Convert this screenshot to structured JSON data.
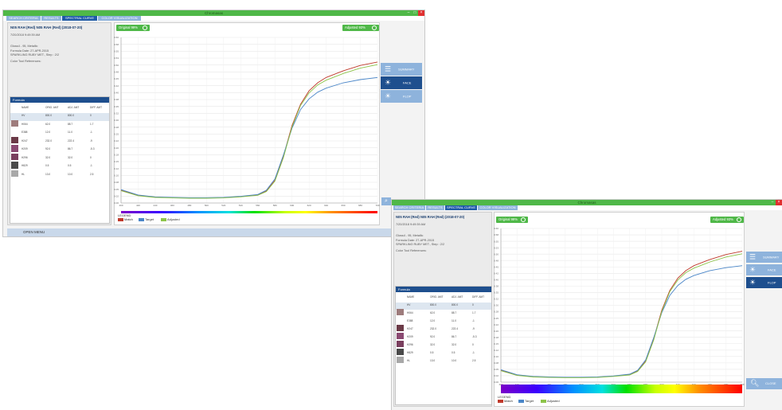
{
  "app": {
    "title": "Chromasas",
    "tabs": [
      "SEARCH CRITERIA",
      "RESULTS",
      "SPECTRAL CURVE",
      "COLOR VISUALIZATION"
    ],
    "active_tab": 2
  },
  "color": {
    "title": "N05 RAH (Red) N05 RAH (Red) (2018-07-20)",
    "date": "7/20/2018 9:49:39 AM",
    "gloss": "Gloss4 - 95, Metallic",
    "formula_date": "Formula Date: 27-APR-2015",
    "variant": "SPARKLING RUBY MET., Step : 2/2",
    "tool_refs": "Color Tool References:"
  },
  "formula": {
    "title": "Formula",
    "columns": [
      "NAME",
      "ORIG. AMT",
      "ADJ. AMT",
      "DIFF. AMT"
    ],
    "rows": [
      {
        "name": "HV",
        "orig": "800.0",
        "adj": "800.0",
        "diff": "0",
        "swatch": null
      },
      {
        "name": "H064",
        "orig": "62.0",
        "adj": "88.7",
        "diff": "1.7",
        "swatch": "#9e7c7c"
      },
      {
        "name": "E388",
        "orig": "12.0",
        "adj": "11.0",
        "diff": "-1",
        "swatch": null
      },
      {
        "name": "H247",
        "orig": "232.0",
        "adj": "222.4",
        "diff": "-9",
        "swatch": "#6b3a47"
      },
      {
        "name": "H209",
        "orig": "92.0",
        "adj": "86.7",
        "diff": "-5.3",
        "swatch": "#8b4a72"
      },
      {
        "name": "H296",
        "orig": "32.0",
        "adj": "32.0",
        "diff": "0",
        "swatch": "#7a3f5e"
      },
      {
        "name": "H829",
        "orig": "0.5",
        "adj": "0.5",
        "diff": "-1",
        "swatch": "#4a4a4a"
      },
      {
        "name": "HL",
        "orig": "13.0",
        "adj": "10.0",
        "diff": "2.5",
        "swatch": "#a8a8a8"
      }
    ]
  },
  "graph": {
    "original_btn": "Original 99%",
    "adjusted_btn": "Adjusted 93%",
    "legend_title": "LEGEND",
    "legend_items": [
      {
        "label": "Match",
        "color": "#c0392b"
      },
      {
        "label": "Target",
        "color": "#4a86c8"
      },
      {
        "label": "Adjusted",
        "color": "#8dc44a"
      }
    ]
  },
  "side": {
    "summary": "SUMMARY",
    "face": "FACE",
    "flop": "FLOP",
    "close": "CLOSE"
  },
  "footer": {
    "open_menu": "OPEN MENU"
  },
  "chart_data": {
    "type": "line",
    "title": "",
    "xlabel": "Wavelength (nm)",
    "ylabel": "Reflectance",
    "x": [
      400,
      420,
      440,
      460,
      480,
      500,
      520,
      540,
      560,
      570,
      580,
      590,
      600,
      610,
      620,
      630,
      640,
      660,
      680,
      700
    ],
    "series": [
      {
        "name": "Match",
        "color": "#c0392b",
        "values": [
          0.048,
          0.028,
          0.022,
          0.02,
          0.019,
          0.019,
          0.02,
          0.024,
          0.03,
          0.045,
          0.085,
          0.175,
          0.29,
          0.37,
          0.42,
          0.45,
          0.47,
          0.495,
          0.515,
          0.528
        ]
      },
      {
        "name": "Target",
        "color": "#4a86c8",
        "values": [
          0.05,
          0.03,
          0.023,
          0.021,
          0.02,
          0.02,
          0.021,
          0.025,
          0.032,
          0.048,
          0.09,
          0.18,
          0.28,
          0.35,
          0.39,
          0.415,
          0.43,
          0.45,
          0.462,
          0.47
        ]
      },
      {
        "name": "Adjusted",
        "color": "#8dc44a",
        "values": [
          0.046,
          0.027,
          0.021,
          0.019,
          0.018,
          0.018,
          0.019,
          0.023,
          0.029,
          0.043,
          0.082,
          0.17,
          0.285,
          0.365,
          0.412,
          0.442,
          0.46,
          0.485,
          0.505,
          0.518
        ]
      }
    ],
    "xlim": [
      400,
      700
    ],
    "ylim": [
      0.0,
      0.62
    ],
    "x_ticks": [
      400,
      420,
      440,
      460,
      480,
      500,
      520,
      540,
      560,
      580,
      600,
      620,
      640,
      660,
      680,
      700
    ],
    "y_ticks": [
      "0.00",
      "0.02",
      "0.05",
      "0.08",
      "0.10",
      "0.12",
      "0.15",
      "0.18",
      "0.20",
      "0.22",
      "0.25",
      "0.28",
      "0.30",
      "0.32",
      "0.35",
      "0.38",
      "0.40",
      "0.42",
      "0.45",
      "0.48",
      "0.50",
      "0.53",
      "0.55",
      "0.58",
      "0.60"
    ],
    "grid": true,
    "legend": "bottom-left"
  }
}
